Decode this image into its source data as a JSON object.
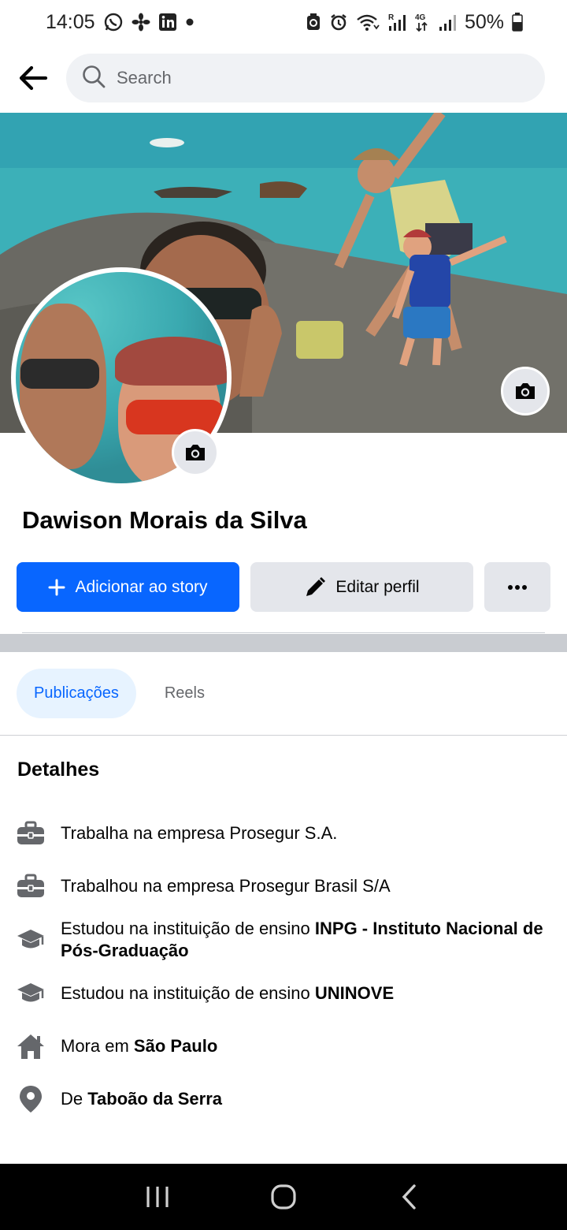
{
  "status_bar": {
    "time": "14:05",
    "battery": "50%"
  },
  "search": {
    "placeholder": "Search"
  },
  "profile": {
    "name": "Dawison Morais da Silva"
  },
  "actions": {
    "add_story": "Adicionar ao story",
    "edit_profile": "Editar perfil"
  },
  "tabs": [
    {
      "label": "Publicações",
      "active": true
    },
    {
      "label": "Reels",
      "active": false
    }
  ],
  "details": {
    "title": "Detalhes",
    "items": [
      {
        "icon": "briefcase-icon",
        "prefix": "Trabalha na empresa Prosegur S.A.",
        "bold": ""
      },
      {
        "icon": "briefcase-icon",
        "prefix": "Trabalhou na empresa Prosegur Brasil S/A",
        "bold": ""
      },
      {
        "icon": "graduation-cap-icon",
        "prefix": "Estudou na instituição de ensino ",
        "bold": "INPG - Instituto Nacional de Pós-Graduação"
      },
      {
        "icon": "graduation-cap-icon",
        "prefix": "Estudou na instituição de ensino ",
        "bold": "UNINOVE"
      },
      {
        "icon": "home-icon",
        "prefix": "Mora em ",
        "bold": "São Paulo"
      },
      {
        "icon": "location-pin-icon",
        "prefix": "De ",
        "bold": "Taboão da Serra"
      }
    ]
  },
  "colors": {
    "primary": "#0866ff",
    "secondary_bg": "#e4e6eb",
    "tab_active_bg": "#e7f3ff"
  }
}
